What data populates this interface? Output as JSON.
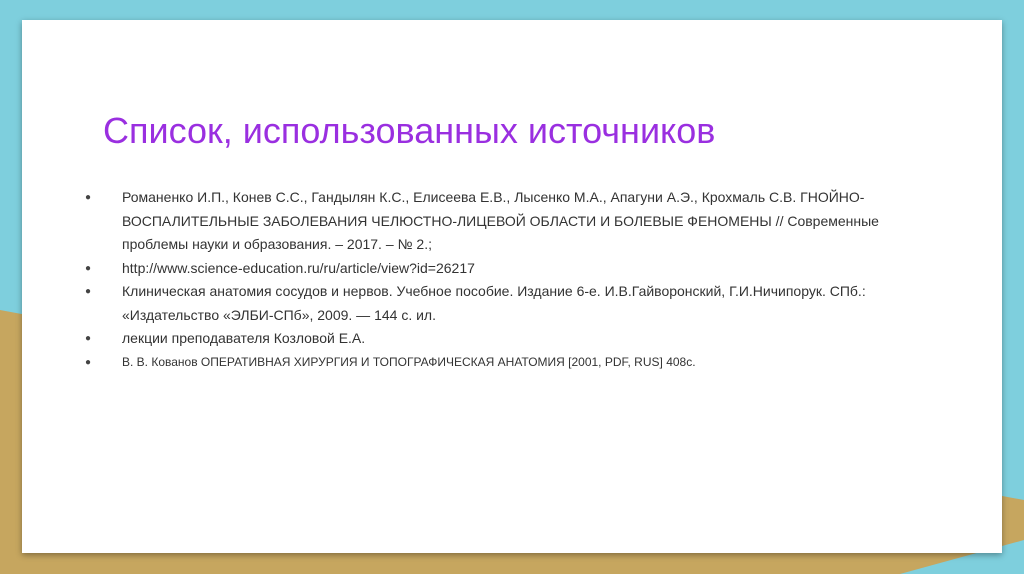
{
  "slide": {
    "title": "Список, использованных источников",
    "references": [
      {
        "bullet": "●",
        "text": "Романенко И.П., Конев С.С., Гандылян К.С., Елисеева Е.В., Лысенко М.А., Апагуни А.Э., Крохмаль С.В. ГНОЙНО-ВОСПАЛИТЕЛЬНЫЕ ЗАБОЛЕВАНИЯ ЧЕЛЮСТНО-ЛИЦЕВОЙ ОБЛАСТИ И БОЛЕВЫЕ ФЕНОМЕНЫ // Современные проблемы науки и образования. – 2017. – № 2.;"
      },
      {
        "bullet": "●",
        "text": "http://www.science-education.ru/ru/article/view?id=26217"
      },
      {
        "bullet": "●",
        "text": "Клиническая анатомия сосудов и нервов. Учебное пособие. Издание 6-е. И.В.Гайворонский, Г.И.Ничипорук. СПб.: «Издательство «ЭЛБИ-СПб», 2009. — 144 с. ил."
      },
      {
        "bullet": "●",
        "text": "лекции преподавателя Козловой Е.А."
      },
      {
        "bullet": "●",
        "text": "В. В. Кованов ОПЕРАТИВНАЯ ХИРУРГИЯ И ТОПОГРАФИЧЕСКАЯ АНАТОМИЯ [2001, PDF, RUS] 408с."
      }
    ]
  },
  "colors": {
    "title": "#9a2fe0",
    "background_teal": "#7ecfdd",
    "background_tan": "#c6a65f",
    "body_text": "#333333"
  }
}
